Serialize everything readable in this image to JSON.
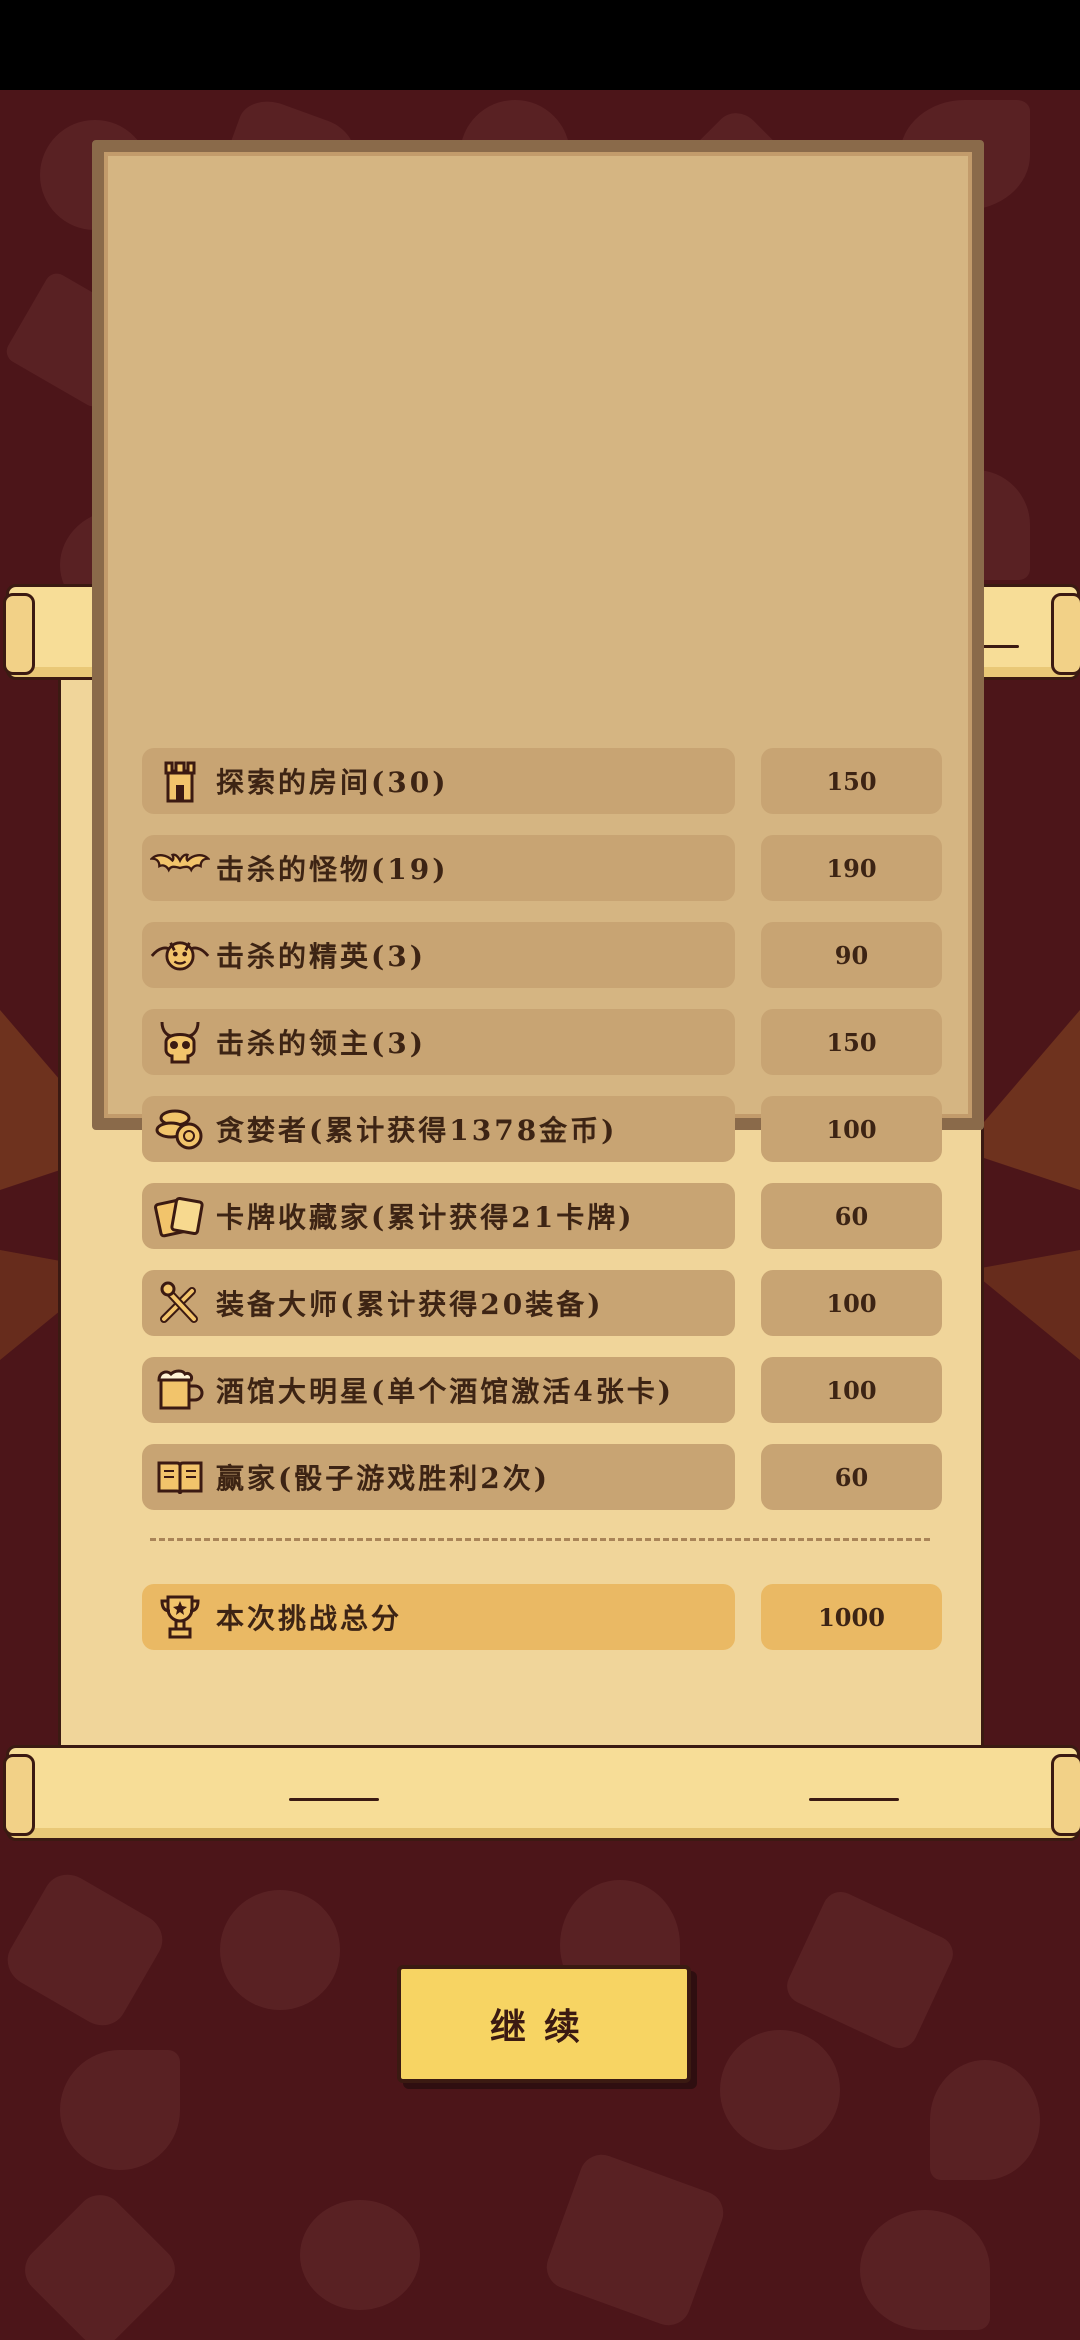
{
  "scores": {
    "items": [
      {
        "label": "探索的房间(30)",
        "value": "150",
        "icon": "tower-icon"
      },
      {
        "label": "击杀的怪物(19)",
        "value": "190",
        "icon": "bat-icon"
      },
      {
        "label": "击杀的精英(3)",
        "value": "90",
        "icon": "winged-demon-icon"
      },
      {
        "label": "击杀的领主(3)",
        "value": "150",
        "icon": "horned-skull-icon"
      },
      {
        "label": "贪婪者(累计获得1378金币)",
        "value": "100",
        "icon": "coin-stack-icon"
      },
      {
        "label": "卡牌收藏家(累计获得21卡牌)",
        "value": "60",
        "icon": "cards-icon"
      },
      {
        "label": "装备大师(累计获得20装备)",
        "value": "100",
        "icon": "crossed-weapons-icon"
      },
      {
        "label": "酒馆大明星(单个酒馆激活4张卡)",
        "value": "100",
        "icon": "beer-mug-icon"
      },
      {
        "label": "赢家(骰子游戏胜利2次)",
        "value": "60",
        "icon": "open-book-icon"
      }
    ],
    "total": {
      "label": "本次挑战总分",
      "value": "1000",
      "icon": "trophy-icon"
    }
  },
  "continue_label": "继续",
  "colors": {
    "background": "#4c1519",
    "parchment": "#f0d59a",
    "row_pill": "#c8a473",
    "total_pill": "#eab964",
    "button": "#f7d463",
    "text": "#3d2414"
  }
}
